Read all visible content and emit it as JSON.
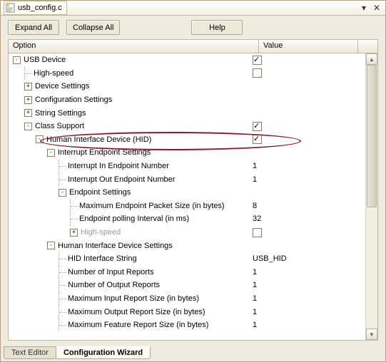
{
  "titlebar": {
    "filename": "usb_config.c"
  },
  "toolbar": {
    "expand_label": "Expand All",
    "collapse_label": "Collapse All",
    "help_label": "Help"
  },
  "columns": {
    "option": "Option",
    "value": "Value"
  },
  "bottom_tabs": {
    "text_editor": "Text Editor",
    "config_wizard": "Configuration Wizard"
  },
  "tree": {
    "usb": {
      "label": "USB Device",
      "checked": true
    },
    "highspeed": {
      "label": "High-speed",
      "checked": false
    },
    "dev_settings": {
      "label": "Device Settings"
    },
    "cfg_settings": {
      "label": "Configuration Settings"
    },
    "str_settings": {
      "label": "String Settings"
    },
    "class_support": {
      "label": "Class Support",
      "checked": true
    },
    "hid": {
      "label": "Human Interface Device (HID)",
      "checked": true
    },
    "int_ep_settings": {
      "label": "Interrupt Endpoint Settings"
    },
    "int_in_ep": {
      "label": "Interrupt In Endpoint Number",
      "value": "1"
    },
    "int_out_ep": {
      "label": "Interrupt Out Endpoint Number",
      "value": "1"
    },
    "ep_settings": {
      "label": "Endpoint Settings"
    },
    "max_ep_pkt": {
      "label": "Maximum Endpoint Packet Size (in bytes)",
      "value": "8"
    },
    "ep_poll": {
      "label": "Endpoint polling Interval (in ms)",
      "value": "32"
    },
    "hs2": {
      "label": "High-speed",
      "checked": false,
      "disabled": true
    },
    "hid_settings": {
      "label": "Human Interface Device Settings"
    },
    "hid_if_str": {
      "label": "HID Interface String",
      "value": "USB_HID"
    },
    "num_in_rep": {
      "label": "Number of Input Reports",
      "value": "1"
    },
    "num_out_rep": {
      "label": "Number of Output Reports",
      "value": "1"
    },
    "max_in_rep": {
      "label": "Maximum Input Report Size (in bytes)",
      "value": "1"
    },
    "max_out_rep": {
      "label": "Maximum Output Report Size (in bytes)",
      "value": "1"
    },
    "max_feat_rep": {
      "label": "Maximum Feature Report Size (in bytes)",
      "value": "1"
    }
  }
}
